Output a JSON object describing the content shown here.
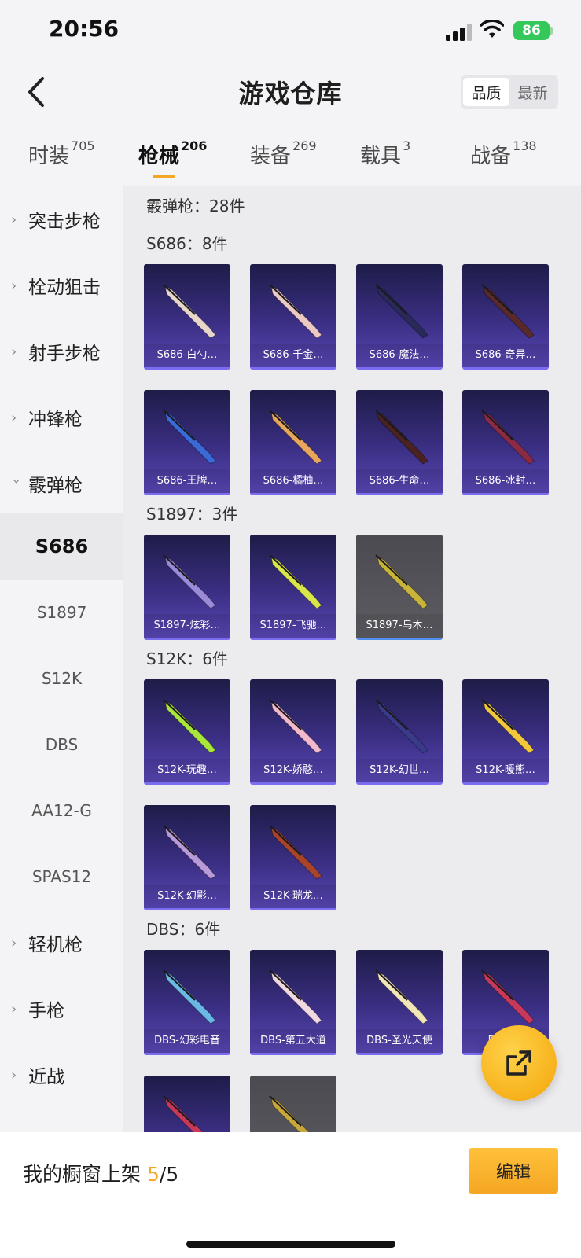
{
  "status_bar": {
    "time": "20:56",
    "battery": "86"
  },
  "header": {
    "title": "游戏仓库",
    "sort_options": [
      "品质",
      "最新"
    ],
    "sort_active": "品质"
  },
  "category_tabs": [
    {
      "label": "时装",
      "count": "705",
      "active": false
    },
    {
      "label": "枪械",
      "count": "206",
      "active": true
    },
    {
      "label": "装备",
      "count": "269",
      "active": false
    },
    {
      "label": "载具",
      "count": "3",
      "active": false
    },
    {
      "label": "战备",
      "count": "138",
      "active": false
    }
  ],
  "sidebar": {
    "items": [
      {
        "label": "突击步枪",
        "expanded": false
      },
      {
        "label": "栓动狙击",
        "expanded": false
      },
      {
        "label": "射手步枪",
        "expanded": false
      },
      {
        "label": "冲锋枪",
        "expanded": false
      },
      {
        "label": "霰弹枪",
        "expanded": true
      }
    ],
    "subitems": [
      {
        "label": "S686",
        "active": true
      },
      {
        "label": "S1897",
        "active": false
      },
      {
        "label": "S12K",
        "active": false
      },
      {
        "label": "DBS",
        "active": false
      },
      {
        "label": "AA12-G",
        "active": false
      },
      {
        "label": "SPAS12",
        "active": false
      }
    ],
    "items_after": [
      {
        "label": "轻机枪"
      },
      {
        "label": "手枪"
      },
      {
        "label": "近战"
      }
    ]
  },
  "main": {
    "category_summary": "霰弹枪：28件",
    "sections": [
      {
        "title": "S686：8件",
        "cards": [
          {
            "name": "S686-白勺…",
            "color": "#e8d6cc"
          },
          {
            "name": "S686-千金…",
            "color": "#ecc9c2"
          },
          {
            "name": "S686-魔法…",
            "color": "#2a2a5a"
          },
          {
            "name": "S686-奇异…",
            "color": "#5a2a2a"
          },
          {
            "name": "S686-王牌…",
            "color": "#3a6ad8"
          },
          {
            "name": "S686-橘柚…",
            "color": "#e8a65c"
          },
          {
            "name": "S686-生命…",
            "color": "#4a2222"
          },
          {
            "name": "S686-冰封…",
            "color": "#8a2a44"
          }
        ]
      },
      {
        "title": "S1897：3件",
        "cards": [
          {
            "name": "S1897-炫彩…",
            "color": "#9a8ad8"
          },
          {
            "name": "S1897-飞驰…",
            "color": "#d8e64a"
          },
          {
            "name": "S1897-乌木…",
            "color": "#c8b43a",
            "grey": true
          }
        ]
      },
      {
        "title": "S12K：6件",
        "cards": [
          {
            "name": "S12K-玩趣…",
            "color": "#a8e63a"
          },
          {
            "name": "S12K-娇憨…",
            "color": "#f2b8cc"
          },
          {
            "name": "S12K-幻世…",
            "color": "#3a3a8a"
          },
          {
            "name": "S12K-暖熊…",
            "color": "#f2c83a"
          },
          {
            "name": "S12K-幻影…",
            "color": "#b89ad8"
          },
          {
            "name": "S12K-瑞龙…",
            "color": "#a8442a"
          }
        ]
      },
      {
        "title": "DBS：6件",
        "cards": [
          {
            "name": "DBS-幻彩电音",
            "color": "#6ab8e6"
          },
          {
            "name": "DBS-第五大道",
            "color": "#f2d8e0"
          },
          {
            "name": "DBS-圣光天使",
            "color": "#f2e6b8"
          },
          {
            "name": "DBS-…",
            "color": "#c8385a"
          },
          {
            "name": "",
            "color": "#c8385a"
          },
          {
            "name": "",
            "color": "#c8a83a",
            "grey": true
          }
        ]
      }
    ]
  },
  "bottom_bar": {
    "shelf_label": "我的橱窗上架",
    "shelf_current": "5",
    "shelf_total": "/5",
    "edit_label": "编辑"
  },
  "colors": {
    "accent": "#f5a623",
    "card_top": "#1e1c48",
    "card_bottom": "#5847b4"
  }
}
